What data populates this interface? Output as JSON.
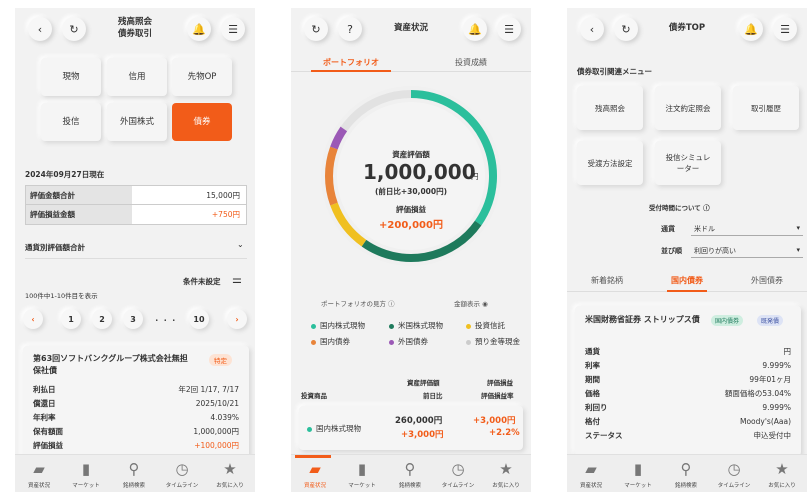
{
  "screen1": {
    "title_line1": "残高照会",
    "title_line2": "債券取引",
    "asset_buttons": [
      "現物",
      "信用",
      "先物OP",
      "投信",
      "外国株式",
      "債券"
    ],
    "as_of": "2024年09月27日現在",
    "summary": [
      {
        "label": "評価金額合計",
        "value": "15,000円"
      },
      {
        "label": "評価損益金額",
        "value": "+750円"
      }
    ],
    "currency_section": "通貨別評価額合計",
    "condition_label": "条件未設定",
    "count_text": "100件中1-10件目を表示",
    "pages": [
      "1",
      "2",
      "3",
      "・・・",
      "10"
    ],
    "card": {
      "name": "第63回ソフトバンクグループ株式会社無担保社債",
      "badge": "特定",
      "rows": [
        {
          "label": "利払日",
          "value": "年2回 1/17, 7/17"
        },
        {
          "label": "償還日",
          "value": "2025/10/21"
        },
        {
          "label": "年利率",
          "value": "4.039%"
        },
        {
          "label": "保有額面",
          "value": "1,000,000円"
        },
        {
          "label": "評価損益",
          "value": "+100,000円"
        }
      ]
    }
  },
  "screen2": {
    "title": "資産状況",
    "tabs": [
      "ポートフォリオ",
      "投資成績"
    ],
    "donut": {
      "label": "資産評価額",
      "value": "1,000,000",
      "unit": "円",
      "change": "(前日比+30,000円)",
      "pl_label": "評価損益",
      "pl_value": "+200,000円"
    },
    "legend_hint": "ポートフォリオの見方",
    "amount_toggle": "金額表示",
    "legend": [
      {
        "label": "国内株式現物",
        "color": "#2bbf9c"
      },
      {
        "label": "米国株式現物",
        "color": "#1e7a5c"
      },
      {
        "label": "投資信託",
        "color": "#f0c020"
      },
      {
        "label": "国内債券",
        "color": "#e8843a"
      },
      {
        "label": "外国債券",
        "color": "#9b59b6"
      },
      {
        "label": "預り金等現金",
        "color": "#cccccc"
      }
    ],
    "table_headers": {
      "product": "投資商品",
      "valuation_line1": "資産評価額",
      "valuation_line2": "前日比",
      "pl_line1": "評価損益",
      "pl_line2": "評価損益率"
    },
    "table_row": {
      "name": "国内株式現物",
      "valuation": "260,000円",
      "day_change": "+3,000円",
      "pl": "+3,000円",
      "pl_rate": "+2.2%"
    }
  },
  "screen3": {
    "title": "債券TOP",
    "menu_heading": "債券取引関連メニュー",
    "menu": [
      "残高照会",
      "注文約定照会",
      "取引履歴",
      "受渡方法設定",
      "投信シミュレーター"
    ],
    "time_note": "受付時間について",
    "currency_label": "通貨",
    "currency_value": "米ドル",
    "sort_label": "並び順",
    "sort_value": "利回りが高い",
    "tabs": [
      "新着銘柄",
      "国内債券",
      "外国債券"
    ],
    "bond": {
      "name": "米国財務省証券 ストリップス債",
      "badges": [
        "国内債券",
        "既発債"
      ],
      "rows": [
        {
          "label": "通貨",
          "value": "円"
        },
        {
          "label": "利率",
          "value": "9.999%"
        },
        {
          "label": "期間",
          "value": "99年01ヶ月"
        },
        {
          "label": "価格",
          "value": "額面価格の53.04%"
        },
        {
          "label": "利回り",
          "value": "9.999%"
        },
        {
          "label": "格付",
          "value": "Moody's(Aaa)"
        },
        {
          "label": "ステータス",
          "value": "申込受付中"
        }
      ]
    }
  },
  "nav": [
    "資産状況",
    "マーケット",
    "銘柄検索",
    "タイムライン",
    "お気に入り"
  ],
  "colors": {
    "accent": "#f25c19",
    "teal": "#2bbf9c",
    "green": "#1e7a5c"
  }
}
